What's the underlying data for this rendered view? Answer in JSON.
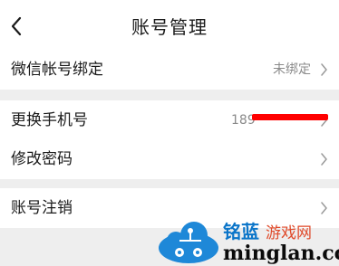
{
  "header": {
    "title": "账号管理",
    "back_icon": "chevron-left-icon"
  },
  "rows": {
    "wechat": {
      "label": "微信帐号绑定",
      "value": "未绑定"
    },
    "phone": {
      "label": "更换手机号",
      "value": "189"
    },
    "password": {
      "label": "修改密码"
    },
    "cancel": {
      "label": "账号注销"
    }
  },
  "colors": {
    "background": "#ffffff",
    "separator": "#eeeeee",
    "secondary_text": "#8a8a8a",
    "redaction": "#ff0000"
  },
  "watermark": {
    "brand_left": "铭蓝",
    "brand_right": "游戏网",
    "domain": "minglan.cc"
  }
}
